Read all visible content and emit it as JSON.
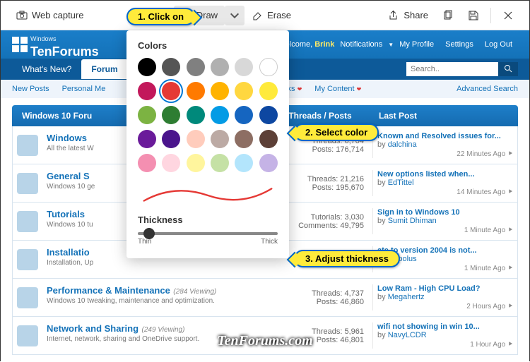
{
  "toolbar": {
    "capture": "Web capture",
    "draw": "Draw",
    "erase": "Erase",
    "share": "Share"
  },
  "callouts": {
    "c1": "1. Click on",
    "c2": "2. Select color",
    "c3": "3. Adjust thickness"
  },
  "popup": {
    "colors_label": "Colors",
    "thickness_label": "Thickness",
    "thin": "Thin",
    "thick": "Thick",
    "colors": [
      "#000000",
      "#555555",
      "#808080",
      "#b0b0b0",
      "#d8d8d8",
      "#ffffff",
      "#c2185b",
      "#e53935",
      "#ff7a00",
      "#ffb300",
      "#ffd740",
      "#ffea3b",
      "#7cb342",
      "#2e7d32",
      "#00897b",
      "#039be5",
      "#1565c0",
      "#0d47a1",
      "#6a1b9a",
      "#4a148c",
      "#ffccbc",
      "#bcaaa4",
      "#8d6e63",
      "#5d4037",
      "#f48fb1",
      "#ffd6e0",
      "#fff59d",
      "#c5e1a5",
      "#b3e5fc",
      "#c5b3e6"
    ],
    "selected_index": 7
  },
  "banner": {
    "logo_small": "Windows",
    "logo_main": "TenForums",
    "welcome": "Welcome,",
    "user": "Brink",
    "links": [
      "Notifications",
      "My Profile",
      "Settings",
      "Log Out"
    ]
  },
  "navbar": {
    "tabs": [
      "What's New?",
      "Forum"
    ],
    "active": 1,
    "search_placeholder": "Search.."
  },
  "subnav": {
    "items": [
      "New Posts",
      "Personal Me",
      "ick Links",
      "My Content"
    ],
    "right": "Advanced Search"
  },
  "forum_header": {
    "title": "Windows 10 Foru",
    "col2": "Threads / Posts",
    "col3": "Last Post"
  },
  "rows": [
    {
      "title": "Windows",
      "desc": "All the latest W",
      "t": "Threads: 6,704",
      "p": "Posts: 176,714",
      "pt": "Known and Resolved issues for...",
      "by": "dalchina",
      "time": "22 Minutes Ago"
    },
    {
      "title": "General S",
      "desc": "Windows 10 ge",
      "t": "Threads: 21,216",
      "p": "Posts: 195,670",
      "pt": "New options listed when...",
      "by": "EdTittel",
      "time": "14 Minutes Ago"
    },
    {
      "title": "Tutorials",
      "desc": "Windows 10 tu",
      "t": "Tutorials: 3,030",
      "p": "Comments: 49,795",
      "pt": "Sign in to Windows 10",
      "by": "Sumit Dhiman",
      "time": "1 Minute Ago"
    },
    {
      "title": "Installatio",
      "desc": "Installation, Up",
      "t": "",
      "p": "",
      "pt": "ate to version 2004 is not...",
      "by": "ktopolus",
      "time": "1 Minute Ago"
    },
    {
      "title": "Performance & Maintenance",
      "view": "(284 Viewing)",
      "desc": "Windows 10 tweaking, maintenance and optimization.",
      "t": "Threads: 4,737",
      "p": "Posts: 46,860",
      "pt": "Low Ram - High CPU Load?",
      "by": "Megahertz",
      "time": "2 Hours Ago"
    },
    {
      "title": "Network and Sharing",
      "view": "(249 Viewing)",
      "desc": "Internet, network, sharing and OneDrive support.",
      "t": "Threads: 5,961",
      "p": "Posts: 46,801",
      "pt": "wifi not showing in win 10...",
      "by": "NavyLCDR",
      "time": "1 Hour Ago"
    }
  ],
  "watermark": "TenForums.com"
}
